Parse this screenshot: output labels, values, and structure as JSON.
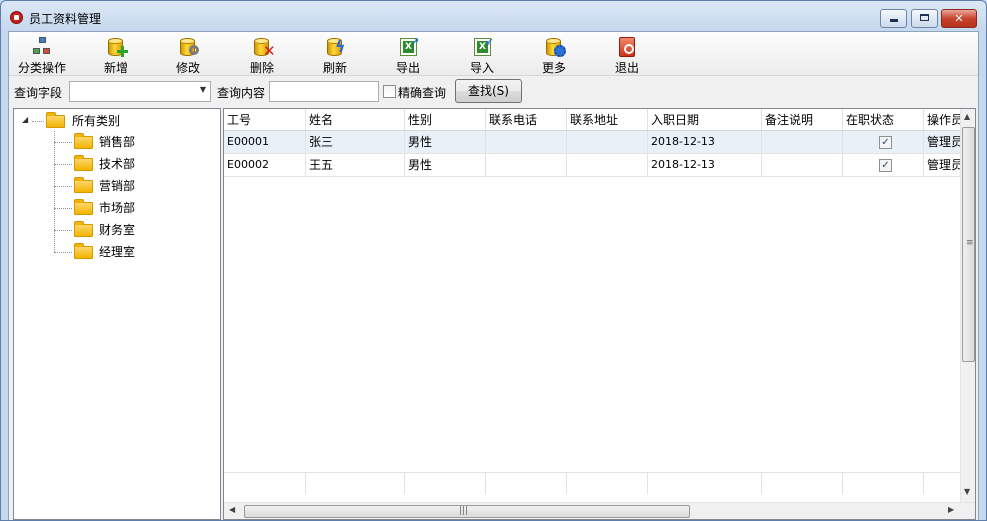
{
  "window": {
    "title": "员工资料管理",
    "minimize": "minimize",
    "maximize": "maximize",
    "close": "✕"
  },
  "toolbar": {
    "items": [
      {
        "label": "分类操作",
        "icon": "category-tree-icon"
      },
      {
        "label": "新增",
        "icon": "add-database-icon"
      },
      {
        "label": "修改",
        "icon": "edit-database-icon"
      },
      {
        "label": "删除",
        "icon": "delete-database-icon"
      },
      {
        "label": "刷新",
        "icon": "refresh-database-icon"
      },
      {
        "label": "导出",
        "icon": "excel-export-icon"
      },
      {
        "label": "导入",
        "icon": "excel-import-icon"
      },
      {
        "label": "更多",
        "icon": "more-settings-icon"
      },
      {
        "label": "退出",
        "icon": "exit-icon"
      }
    ]
  },
  "query": {
    "field_label": "查询字段",
    "field_value": "",
    "content_label": "查询内容",
    "content_value": "",
    "exact_label": "精确查询",
    "exact_checked": false,
    "search_button": "查找(S)"
  },
  "tree": {
    "root": "所有类别",
    "children": [
      "销售部",
      "技术部",
      "营销部",
      "市场部",
      "财务室",
      "经理室"
    ]
  },
  "grid": {
    "columns": [
      "工号",
      "姓名",
      "性别",
      "联系电话",
      "联系地址",
      "入职日期",
      "备注说明",
      "在职状态",
      "操作员"
    ],
    "rows": [
      {
        "id": "E00001",
        "name": "张三",
        "gender": "男性",
        "phone": "",
        "address": "",
        "hire_date": "2018-12-13",
        "note": "",
        "active": true,
        "operator": "管理员"
      },
      {
        "id": "E00002",
        "name": "王五",
        "gender": "男性",
        "phone": "",
        "address": "",
        "hire_date": "2018-12-13",
        "note": "",
        "active": true,
        "operator": "管理员"
      }
    ],
    "check_mark": "✓"
  },
  "colors": {
    "title_bg": "#c6d8ee",
    "selected_row": "#e8f0f8",
    "folder": "#f2b300"
  }
}
